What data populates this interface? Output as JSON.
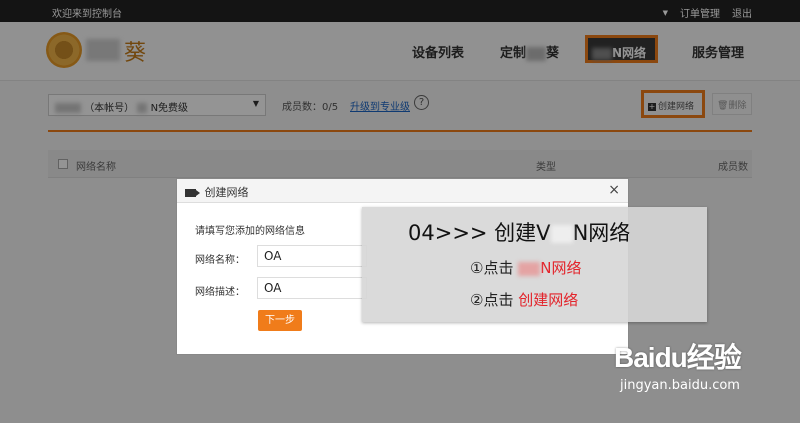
{
  "topbar": {
    "welcome": "欢迎来到控制台",
    "order_mgmt": "订单管理",
    "logout": "退出"
  },
  "header": {
    "logo_text": "葵",
    "nav": {
      "devices": "设备列表",
      "custom_prefix": "定制",
      "custom_suffix": "葵",
      "vpn_suffix": "N网络",
      "service": "服务管理"
    }
  },
  "toolbar": {
    "account_tag": "（本帐号）",
    "account_plan": "N免费级",
    "member_label": "成员数：0/5",
    "upgrade_link": "升级到专业级",
    "help": "?",
    "create_label": "创建网络",
    "delete_label": "删除"
  },
  "table": {
    "columns": [
      "网络名称",
      "类型",
      "成员数"
    ]
  },
  "modal": {
    "title": "创建网络",
    "close": "×",
    "hint": "请填写您添加的网络信息",
    "name_label": "网络名称：",
    "name_value": "OA",
    "desc_label": "网络描述：",
    "desc_value": "OA",
    "next_label": "下一步"
  },
  "overlay": {
    "title_prefix": "04>>>  创建V",
    "title_suffix": "N网络",
    "step1_prefix": "①点击",
    "step1_red": "N网络",
    "step2_prefix": "②点击",
    "step2_red": "创建网络"
  },
  "watermark": {
    "brand": "Baidu经验",
    "url": "jingyan.baidu.com"
  },
  "colors": {
    "accent": "#f07c1a",
    "link": "#1b64c4",
    "highlight_red": "#e3242b"
  }
}
